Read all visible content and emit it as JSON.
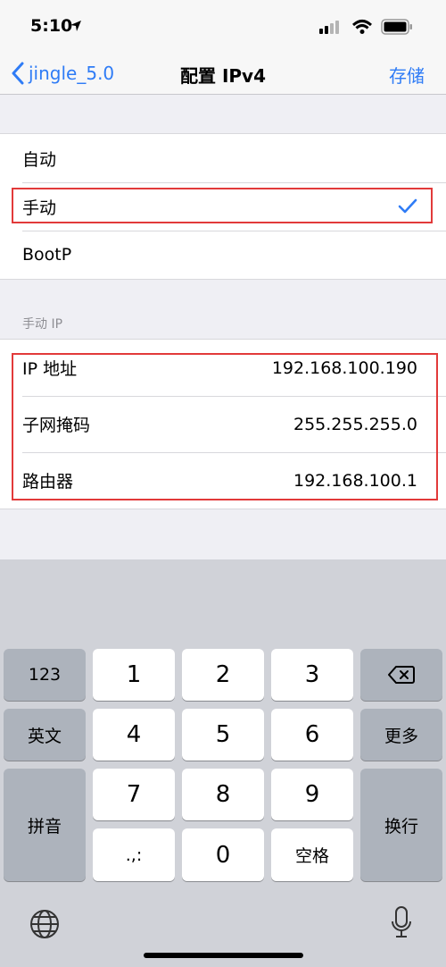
{
  "status_bar": {
    "time": "5:10"
  },
  "nav": {
    "back_label": "jingle_5.0",
    "title": "配置 IPv4",
    "save_label": "存储"
  },
  "config_options": [
    {
      "label": "自动",
      "selected": false
    },
    {
      "label": "手动",
      "selected": true
    },
    {
      "label": "BootP",
      "selected": false
    }
  ],
  "manual_ip": {
    "header": "手动 IP",
    "fields": [
      {
        "label": "IP 地址",
        "value": "192.168.100.190"
      },
      {
        "label": "子网掩码",
        "value": "255.255.255.0"
      },
      {
        "label": "路由器",
        "value": "192.168.100.1"
      }
    ]
  },
  "keyboard": {
    "mode_123": "123",
    "english": "英文",
    "pinyin": "拼音",
    "more": "更多",
    "return": "换行",
    "space": "空格",
    "punct": ".,:",
    "digits": [
      "1",
      "2",
      "3",
      "4",
      "5",
      "6",
      "7",
      "8",
      "9",
      "0"
    ]
  },
  "colors": {
    "accent": "#2f7cf6",
    "highlight": "#e23a3a"
  }
}
